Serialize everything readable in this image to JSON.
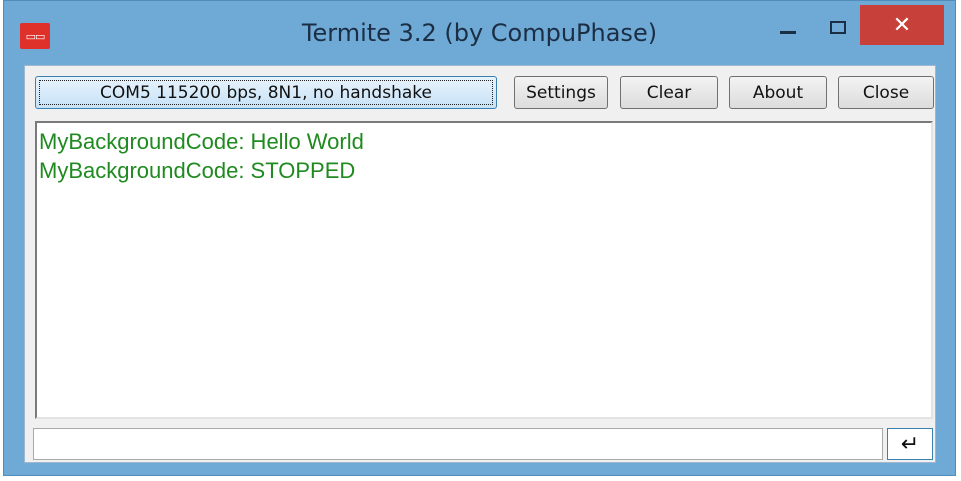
{
  "window": {
    "title": "Termite 3.2 (by CompuPhase)",
    "close_symbol": "✕"
  },
  "toolbar": {
    "port_label": "COM5 115200 bps, 8N1, no handshake",
    "settings_label": "Settings",
    "clear_label": "Clear",
    "about_label": "About",
    "close_label": "Close"
  },
  "output": {
    "lines": [
      "MyBackgroundCode: Hello World",
      "MyBackgroundCode: STOPPED"
    ],
    "text_color": "#1f8a1f"
  },
  "input": {
    "value": "",
    "send_symbol": "↵"
  },
  "colors": {
    "frame": "#6fa9d6",
    "close_button": "#c7403a"
  },
  "icons": {
    "app": "termite-app-icon",
    "minimize": "minimize-icon",
    "maximize": "maximize-icon",
    "close": "close-icon",
    "send": "enter-icon"
  }
}
